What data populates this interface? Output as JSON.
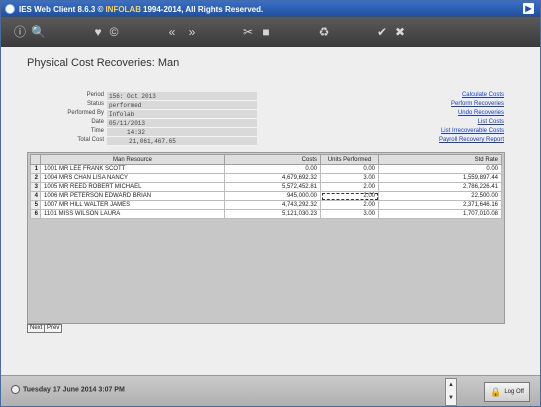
{
  "window": {
    "title_prefix": "IES Web Client 8.6.3 ©",
    "title_brand": "INFOLAB",
    "title_suffix": "1994-2014, All Rights Reserved.",
    "corner_glyph": "▶"
  },
  "toolbar": {
    "icons": [
      {
        "name": "info-icon",
        "glyph": "ⓘ"
      },
      {
        "name": "search-icon",
        "glyph": "🔍"
      },
      {
        "name": "heart-icon",
        "glyph": "♥"
      },
      {
        "name": "copy-icon",
        "glyph": "©"
      },
      {
        "name": "back-icon",
        "glyph": "«"
      },
      {
        "name": "forward-icon",
        "glyph": "»"
      },
      {
        "name": "tools-icon",
        "glyph": "✂"
      },
      {
        "name": "stop-icon",
        "glyph": "■"
      },
      {
        "name": "recycle-icon",
        "glyph": "♻"
      },
      {
        "name": "accept-icon",
        "glyph": "✔"
      },
      {
        "name": "cancel-icon",
        "glyph": "✖"
      }
    ]
  },
  "page": {
    "title": "Physical Cost Recoveries: Man"
  },
  "info": {
    "labels": {
      "period": "Period",
      "status": "Status",
      "performed_by": "Performed By",
      "date": "Date",
      "time": "Time",
      "total_cost": "Total Cost"
    },
    "values": {
      "period": "156: Oct 2013",
      "status": "performed",
      "performed_by": "Infolab",
      "date": "05/11/2013",
      "time": "14:32",
      "total_cost": "21,061,467.65"
    }
  },
  "links": {
    "calculate": "Calculate Costs",
    "perform": "Perform Recoveries",
    "undo": "Undo Recoveries",
    "list": "List Costs",
    "irrecoverable": "List Irrecoverable Costs",
    "payroll": "Payroll Recovery Report"
  },
  "grid": {
    "headers": {
      "resource": "Man Resource",
      "costs": "Costs",
      "units": "Units Performed",
      "rate": "Std Rate"
    },
    "rows": [
      {
        "num": "1",
        "resource": "1001 MR LEE FRANK SCOTT",
        "costs": "0.00",
        "units": "0.00",
        "rate": "0.00"
      },
      {
        "num": "2",
        "resource": "1004 MRS CHAN LISA NANCY",
        "costs": "4,679,692.32",
        "units": "3.00",
        "rate": "1,559,897.44"
      },
      {
        "num": "3",
        "resource": "1005 MR REED ROBERT MICHAEL",
        "costs": "5,572,452.81",
        "units": "2.00",
        "rate": "2,786,226.41"
      },
      {
        "num": "4",
        "resource": "1006 MR PETERSON EDWARD BRIAN",
        "costs": "945,000.00",
        "units": "2.00",
        "rate": "22,500.00"
      },
      {
        "num": "5",
        "resource": "1007 MR HILL WALTER JAMES",
        "costs": "4,743,292.32",
        "units": "2.00",
        "rate": "2,371,646.16"
      },
      {
        "num": "6",
        "resource": "1101 MISS WILSON LAURA",
        "costs": "5,121,030.23",
        "units": "3.00",
        "rate": "1,707,010.08"
      }
    ]
  },
  "nav": {
    "next": "Next",
    "prev": "Prev"
  },
  "status": {
    "date": "Tuesday 17 June 2014 3:07 PM",
    "logoff": "Log Off"
  }
}
